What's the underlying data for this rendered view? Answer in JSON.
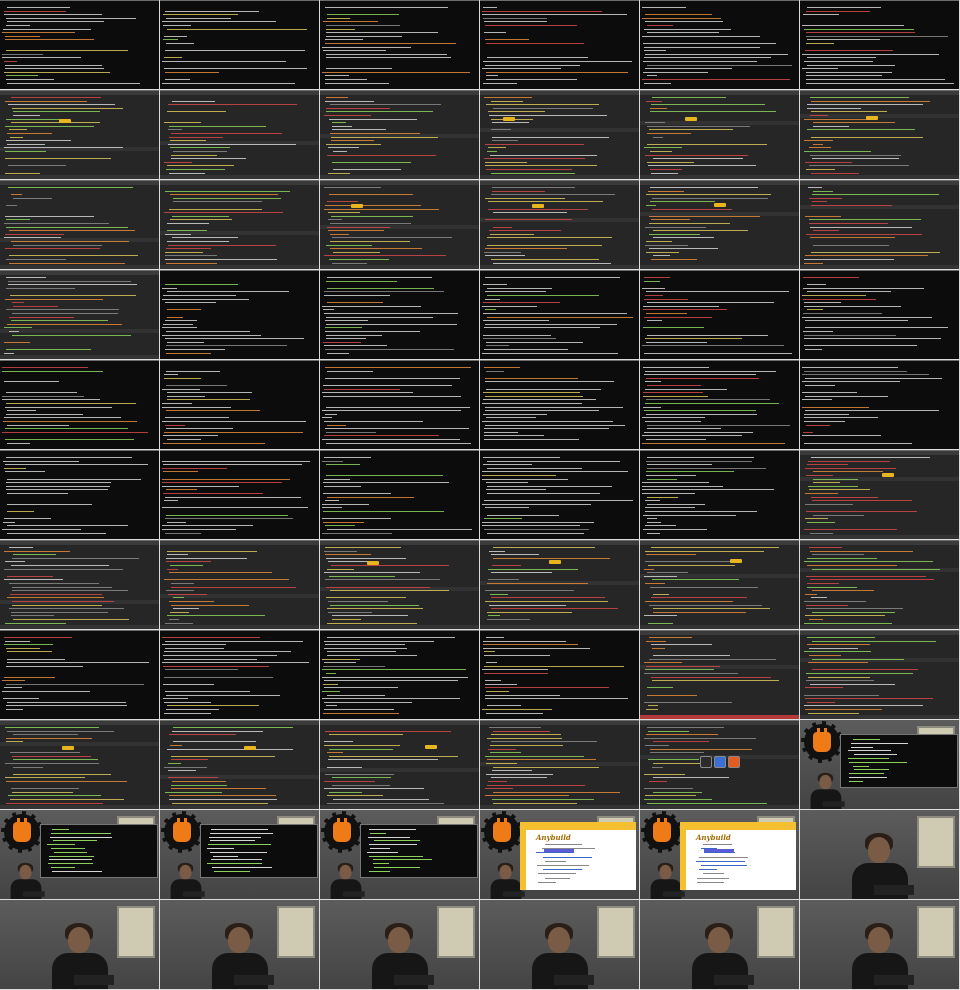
{
  "sheet": {
    "columns": 6,
    "rows": 11,
    "background": "#dcdcdc"
  },
  "colors": {
    "terminal_bg": "#0c0c0c",
    "editor_bg": "#262626",
    "code_green": "#8ad05a",
    "code_orange": "#e0883a",
    "code_red": "#d04848",
    "code_yellow": "#d8c45a",
    "code_white": "#d4d4d4",
    "code_grey": "#8a8a8a",
    "highlight_yellow": "#e8b51f",
    "logo_orange": "#ee7a18",
    "slide_yellow": "#f4c031"
  },
  "slide": {
    "title": "Anybuild",
    "logo_name": "logo-gear-fist"
  },
  "taskbar": {
    "icons": [
      "terminal-icon",
      "editor-icon",
      "firefox-icon"
    ]
  },
  "frames": [
    "term",
    "term",
    "term",
    "term",
    "term",
    "term",
    "edit",
    "edit",
    "edit",
    "edit",
    "edit",
    "edit",
    "edit",
    "edit",
    "edit",
    "edit",
    "edit",
    "edit",
    "edit",
    "term",
    "term",
    "term",
    "term",
    "term",
    "term",
    "term",
    "term",
    "term",
    "term",
    "term",
    "term",
    "term",
    "term",
    "term",
    "term",
    "edit",
    "edit",
    "edit",
    "edit",
    "edit",
    "edit",
    "edit",
    "term",
    "term",
    "term",
    "term",
    "edit-red",
    "edit",
    "edit",
    "edit",
    "edit",
    "edit",
    "edit-taskbar",
    "logo-pip",
    "logo-pip",
    "logo-pip",
    "logo-pip",
    "slide-pip",
    "slide-pip",
    "camera",
    "camera",
    "camera",
    "camera",
    "camera",
    "camera",
    "camera"
  ]
}
